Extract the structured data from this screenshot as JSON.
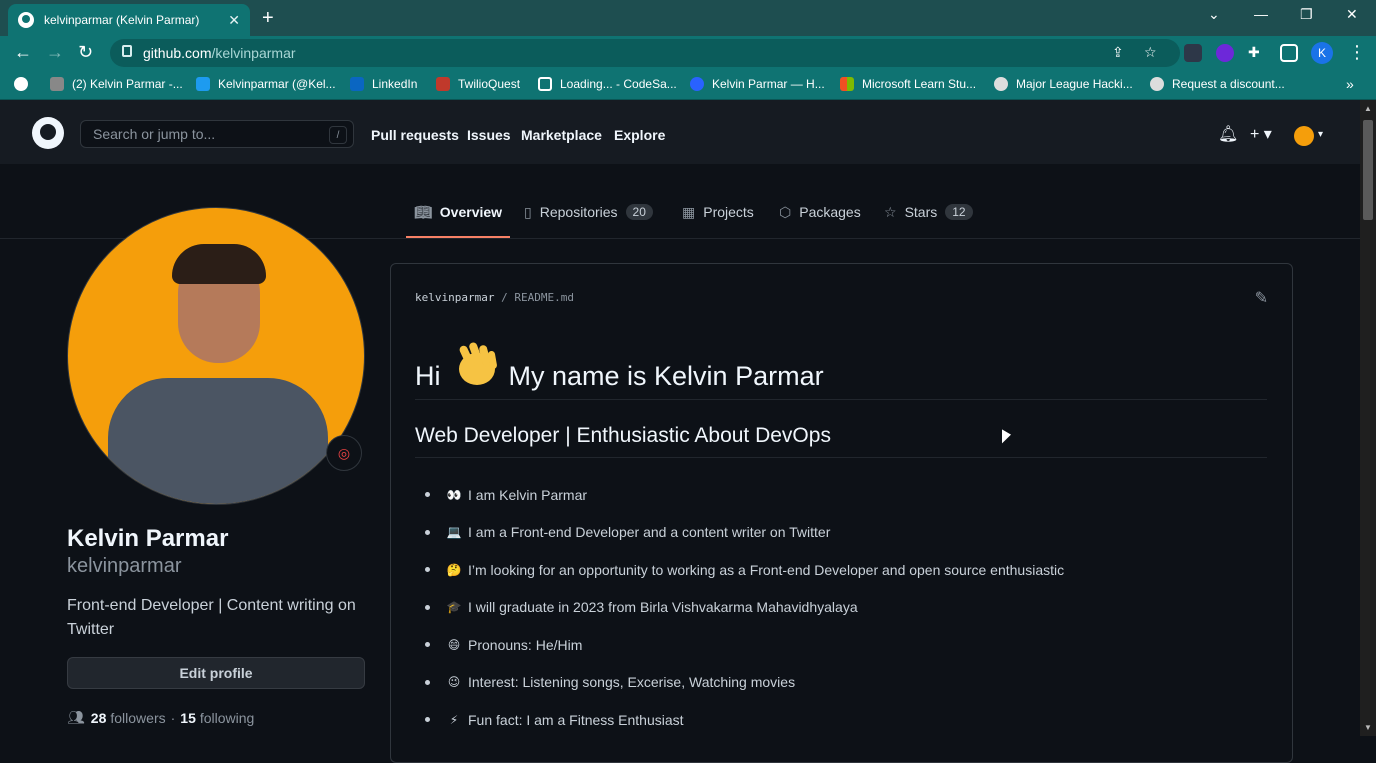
{
  "browser": {
    "tab_title": "kelvinparmar (Kelvin Parmar)",
    "url_host": "github.com",
    "url_path": "/kelvinparmar",
    "profile_initial": "K",
    "bookmarks": [
      {
        "label": "(2) Kelvin Parmar -...",
        "color": "#888888"
      },
      {
        "label": "Kelvinparmar (@Kel...",
        "color": "#1d9bf0"
      },
      {
        "label": "LinkedIn",
        "color": "#0a66c2"
      },
      {
        "label": "TwilioQuest",
        "color": "#c0392b"
      },
      {
        "label": "Loading... - CodeSa...",
        "color": "#ffffff"
      },
      {
        "label": "Kelvin Parmar — H...",
        "color": "#2962ff"
      },
      {
        "label": "Microsoft Learn Stu...",
        "color": "#f25022"
      },
      {
        "label": "Major League Hacki...",
        "color": "#dddddd"
      },
      {
        "label": "Request a discount...",
        "color": "#dddddd"
      }
    ]
  },
  "header": {
    "search_placeholder": "Search or jump to...",
    "slash_key": "/",
    "nav": [
      "Pull requests",
      "Issues",
      "Marketplace",
      "Explore"
    ]
  },
  "tabs": [
    {
      "label": "Overview",
      "icon": "book-icon"
    },
    {
      "label": "Repositories",
      "icon": "repo-icon",
      "count": "20"
    },
    {
      "label": "Projects",
      "icon": "project-icon"
    },
    {
      "label": "Packages",
      "icon": "package-icon"
    },
    {
      "label": "Stars",
      "icon": "star-icon",
      "count": "12"
    }
  ],
  "profile": {
    "name": "Kelvin Parmar",
    "login": "kelvinparmar",
    "bio": "Front-end Developer | Content writing on Twitter",
    "edit_label": "Edit profile",
    "followers_count": "28",
    "followers_label": "followers",
    "separator": "·",
    "following_count": "15",
    "following_label": "following"
  },
  "readme": {
    "owner": "kelvinparmar",
    "file": "README.md",
    "heading_hi": "Hi",
    "heading_rest": "My name is Kelvin Parmar",
    "subheading": "Web Developer | Enthusiastic About DevOps",
    "items": [
      {
        "emoji": "👀",
        "text": "I am Kelvin Parmar"
      },
      {
        "emoji": "💻",
        "text": "I am a Front-end Developer and a content writer on Twitter"
      },
      {
        "emoji": "🤔",
        "text": "I’m looking for an opportunity to working as a Front-end Developer and open source enthusiastic"
      },
      {
        "emoji": "🎓",
        "text": "I will graduate in 2023 from Birla Vishvakarma Mahavidhyalaya"
      },
      {
        "emoji": "😄",
        "text": "Pronouns: He/Him"
      },
      {
        "emoji": "😉",
        "text": "Interest: Listening songs, Excerise, Watching movies"
      },
      {
        "emoji": "⚡",
        "text": "Fun fact: I am a Fitness Enthusiast"
      }
    ]
  },
  "colors": {
    "chrome_tab": "#0f7372",
    "gh_bg": "#0d1117",
    "gh_header": "#161b22",
    "tab_underline": "#f78166",
    "avatar_bg": "#f59e0b"
  }
}
